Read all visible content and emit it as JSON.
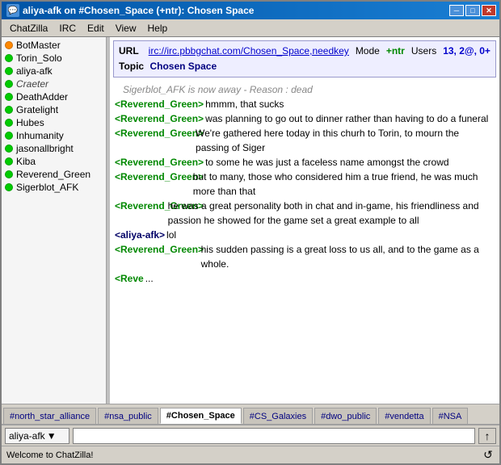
{
  "titlebar": {
    "icon": "💬",
    "text": "aliya-afk on #Chosen_Space (+ntr): Chosen Space",
    "minimize": "─",
    "maximize": "□",
    "close": "✕"
  },
  "menubar": {
    "items": [
      "ChatZilla",
      "IRC",
      "Edit",
      "View",
      "Help"
    ]
  },
  "sidebar": {
    "users": [
      {
        "name": "BotMaster",
        "status": "orange"
      },
      {
        "name": "Torin_Solo",
        "status": "green"
      },
      {
        "name": "aliya-afk",
        "status": "green"
      },
      {
        "name": "Craeter",
        "status": "green"
      },
      {
        "name": "DeathAdder",
        "status": "green"
      },
      {
        "name": "Gratelight",
        "status": "green"
      },
      {
        "name": "Hubes",
        "status": "green"
      },
      {
        "name": "Inhumanity",
        "status": "green"
      },
      {
        "name": "jasonallbright",
        "status": "green"
      },
      {
        "name": "Kiba",
        "status": "green"
      },
      {
        "name": "Reverend_Green",
        "status": "green"
      },
      {
        "name": "Sigerblot_AFK",
        "status": "green"
      }
    ]
  },
  "infobar": {
    "url_label": "URL",
    "url": "irc://irc.pbbgchat.com/Chosen_Space,needkey",
    "mode_label": "Mode",
    "mode": "+ntr",
    "users_label": "Users",
    "users": "13, 2@, 0+",
    "topic_label": "Topic",
    "topic": "Chosen Space"
  },
  "messages": [
    {
      "type": "system",
      "text": "Sigerblot_AFK is now away - Reason : dead"
    },
    {
      "type": "chat",
      "nick": "<Reverend_Green>",
      "text": "hmmm, that sucks"
    },
    {
      "type": "chat",
      "nick": "<Reverend_Green>",
      "text": "was planning to go out to dinner rather than having to do a funeral"
    },
    {
      "type": "chat",
      "nick": "<Reverend_Green>",
      "text": "We're gathered here today in this churh to Torin, to mourn the passing of Siger"
    },
    {
      "type": "chat",
      "nick": "<Reverend_Green>",
      "text": "to some he was just a faceless name amongst the crowd"
    },
    {
      "type": "chat",
      "nick": "<Reverend_Green>",
      "text": "but to many, those who considered him a true friend, he was much more than that"
    },
    {
      "type": "chat",
      "nick": "<Reverend_Green>",
      "text": "he was a great personality both in chat and in-game, his friendliness and passion he showed for the game set a great example to all"
    },
    {
      "type": "chat",
      "nick": "<aliya-afk>",
      "nick_class": "self",
      "text": "lol"
    },
    {
      "type": "chat",
      "nick": "<Reverend_Green>",
      "text": "his sudden passing is a great loss to us all, and to the game as a whole."
    },
    {
      "type": "chat",
      "nick": "<Reve",
      "text": "..."
    }
  ],
  "tabs": [
    {
      "label": "#north_star_alliance",
      "active": false
    },
    {
      "label": "#nsa_public",
      "active": false
    },
    {
      "label": "#Chosen_Space",
      "active": true
    },
    {
      "label": "#CS_Galaxies",
      "active": false
    },
    {
      "label": "#dwo_public",
      "active": false
    },
    {
      "label": "#vendetta",
      "active": false
    },
    {
      "label": "#NSA",
      "active": false
    }
  ],
  "inputbar": {
    "nick": "aliya-afk",
    "dropdown_arrow": "▼",
    "placeholder": "",
    "send_arrow": "↑"
  },
  "statusbar": {
    "text": "Welcome to ChatZilla!",
    "icon": "↺"
  }
}
